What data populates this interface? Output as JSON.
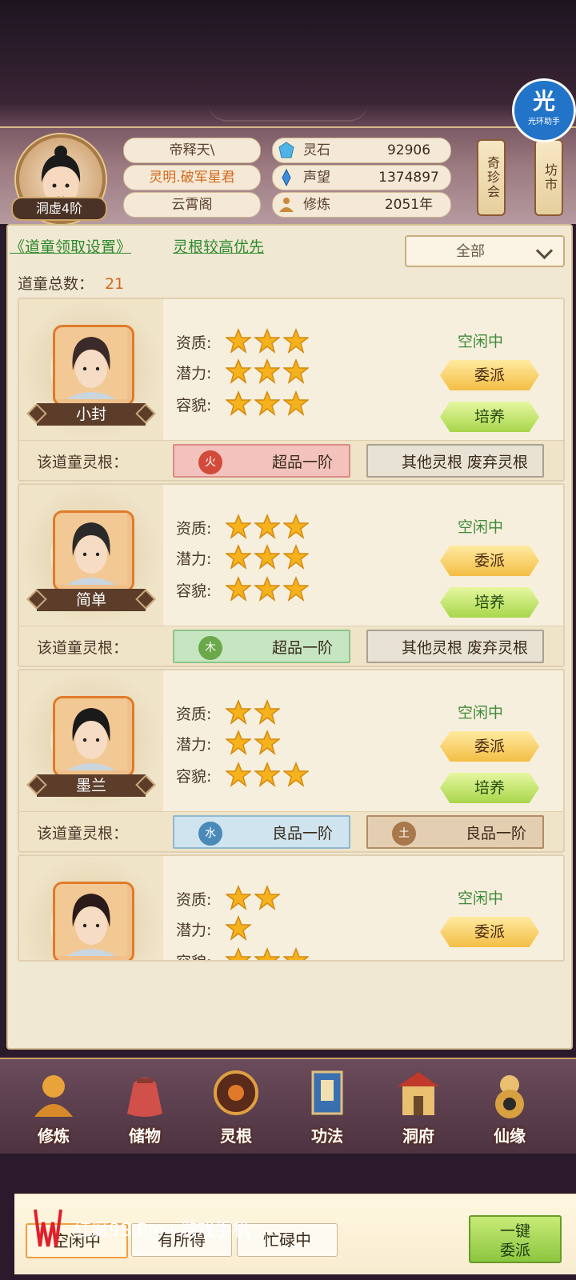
{
  "header": {
    "realm": "洞虚4阶",
    "name": "帝释天\\",
    "title": "灵明.破军星君",
    "sect": "云霄阁",
    "stats": [
      {
        "label": "灵石",
        "value": "92906",
        "icon": "spirit-stone-icon"
      },
      {
        "label": "声望",
        "value": "1374897",
        "icon": "prestige-icon"
      },
      {
        "label": "修炼",
        "value": "2051年",
        "icon": "meditation-icon"
      }
    ],
    "shop1": "奇珍会",
    "shop2": "坊市",
    "helper_big": "光",
    "helper_small": "光环助手"
  },
  "panel": {
    "settings_link": "《道童领取设置》",
    "priority_link": "灵根较高优先",
    "filter_value": "全部",
    "total_label": "道童总数：",
    "total_value": "21",
    "root_label": "该道童灵根：",
    "labels": {
      "quality": "资质:",
      "potential": "潜力:",
      "looks": "容貌:"
    },
    "cards": [
      {
        "name": "小封",
        "quality": 3,
        "potential": 3,
        "looks": 3,
        "status": "空闲中",
        "assign": "委派",
        "train": "培养",
        "root1": {
          "element": "火",
          "grade": "超品一阶",
          "color": "fire"
        },
        "root2": {
          "element": "",
          "grade": "其他灵根 废弃灵根",
          "color": "other"
        }
      },
      {
        "name": "简单",
        "quality": 3,
        "potential": 3,
        "looks": 3,
        "status": "空闲中",
        "assign": "委派",
        "train": "培养",
        "root1": {
          "element": "木",
          "grade": "超品一阶",
          "color": "wood"
        },
        "root2": {
          "element": "",
          "grade": "其他灵根 废弃灵根",
          "color": "other"
        }
      },
      {
        "name": "墨兰",
        "quality": 2,
        "potential": 2,
        "looks": 3,
        "status": "空闲中",
        "assign": "委派",
        "train": "培养",
        "root1": {
          "element": "水",
          "grade": "良品一阶",
          "color": "water"
        },
        "root2": {
          "element": "土",
          "grade": "良品一阶",
          "color": "earth"
        }
      },
      {
        "name": "",
        "quality": 2,
        "potential": 1,
        "looks": 3,
        "status": "空闲中",
        "assign": "委派",
        "train": ""
      }
    ]
  },
  "tabs": [
    "空闲中",
    "有所得",
    "忙碌中"
  ],
  "one_key": [
    "一键",
    "委派"
  ],
  "nav": [
    "修炼",
    "储物",
    "灵根",
    "功法",
    "洞府",
    "仙缘"
  ],
  "phone_label": "红魔9S Pro+游戏手机",
  "colors": {
    "status_green": "#3f8a3a",
    "total_orange": "#d2691e",
    "link_green": "#2d8a2d"
  }
}
